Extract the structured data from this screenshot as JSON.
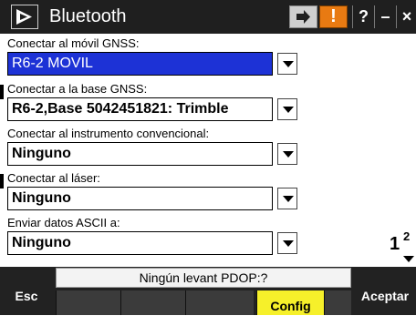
{
  "title": "Bluetooth",
  "titlebar": {
    "app_icon": "bluetooth-app-icon",
    "status_icon": "connection-arrow-icon",
    "warning_label": "!",
    "help_label": "?",
    "minimize_label": "–",
    "close_label": "×"
  },
  "fields": [
    {
      "label": "Conectar al móvil GNSS:",
      "value": "R6-2 MOVIL",
      "selected": true
    },
    {
      "label": "Conectar a la base GNSS:",
      "value": "R6-2,Base 5042451821: Trimble"
    },
    {
      "label": "Conectar al instrumento convencional:",
      "value": "Ninguno"
    },
    {
      "label": "Conectar al láser:",
      "value": "Ninguno"
    },
    {
      "label": "Enviar datos ASCII a:",
      "value": "Ninguno"
    }
  ],
  "page_indicator": {
    "current": "1",
    "total": "2"
  },
  "bottom": {
    "esc_label": "Esc",
    "status_text": "Ningún levant  PDOP:?",
    "config_label": "Config",
    "aceptar_label": "Aceptar"
  },
  "colors": {
    "selected": "#1d32d6",
    "warning": "#e87a12",
    "config": "#f6f02a",
    "bar": "#1f1f1f"
  }
}
